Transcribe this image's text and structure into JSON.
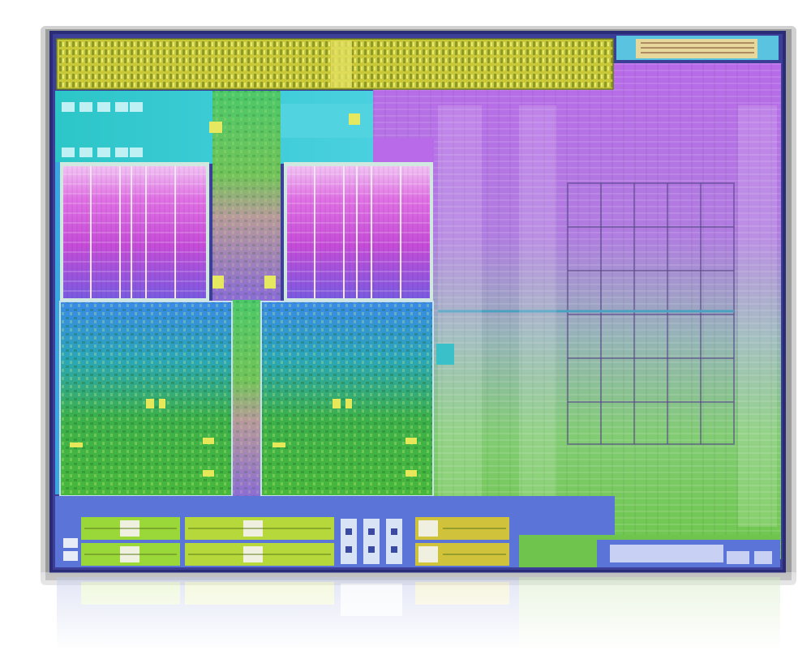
{
  "image": {
    "subject": "die-shot",
    "background_color": "#ffffff",
    "palette": {
      "io_bar": "#c2c43a",
      "cpu_cache": "#d85ce0",
      "cpu_logic": "#3cae4c",
      "cpu_frame": "#3aa2e6",
      "gpu_top": "#b46ee6",
      "gpu_bottom": "#7cd05a",
      "cyan_region": "#39c6d6",
      "border": "#383c92",
      "bottom_strip": "#5a72d6"
    }
  }
}
